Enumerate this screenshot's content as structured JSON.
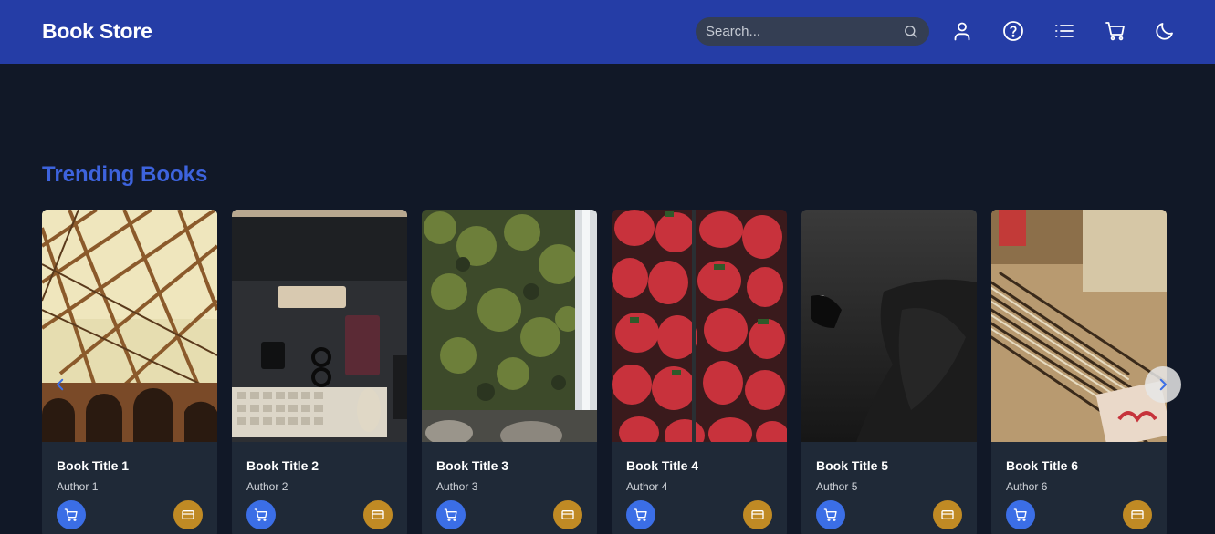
{
  "header": {
    "brand": "Book Store",
    "search": {
      "placeholder": "Search...",
      "value": ""
    },
    "icons": [
      "user-icon",
      "help-icon",
      "list-icon",
      "cart-icon",
      "moon-icon"
    ],
    "colors": {
      "navbar": "#253da6",
      "search_bg": "#343e53"
    }
  },
  "main": {
    "section_title": "Trending Books",
    "section_title_color": "#3d63dd",
    "carousel": {
      "prev_icon": "chevron-left-icon",
      "next_icon": "chevron-right-icon"
    },
    "books": [
      {
        "title": "Book Title 1",
        "author": "Author 1",
        "cover": "bridge-photo"
      },
      {
        "title": "Book Title 2",
        "author": "Author 2",
        "cover": "desk-keyboard-photo"
      },
      {
        "title": "Book Title 3",
        "author": "Author 3",
        "cover": "waterfall-photo"
      },
      {
        "title": "Book Title 4",
        "author": "Author 4",
        "cover": "strawberries-photo"
      },
      {
        "title": "Book Title 5",
        "author": "Author 5",
        "cover": "diver-photo"
      },
      {
        "title": "Book Title 6",
        "author": "Author 6",
        "cover": "pencils-photo"
      }
    ],
    "card_actions": {
      "cart_icon": "cart-icon",
      "buy_icon": "credit-card-icon",
      "cart_color": "#3b6ee6",
      "buy_color": "#c08a24"
    }
  },
  "theme": {
    "background": "#111827",
    "card_bg": "#1f2937"
  }
}
